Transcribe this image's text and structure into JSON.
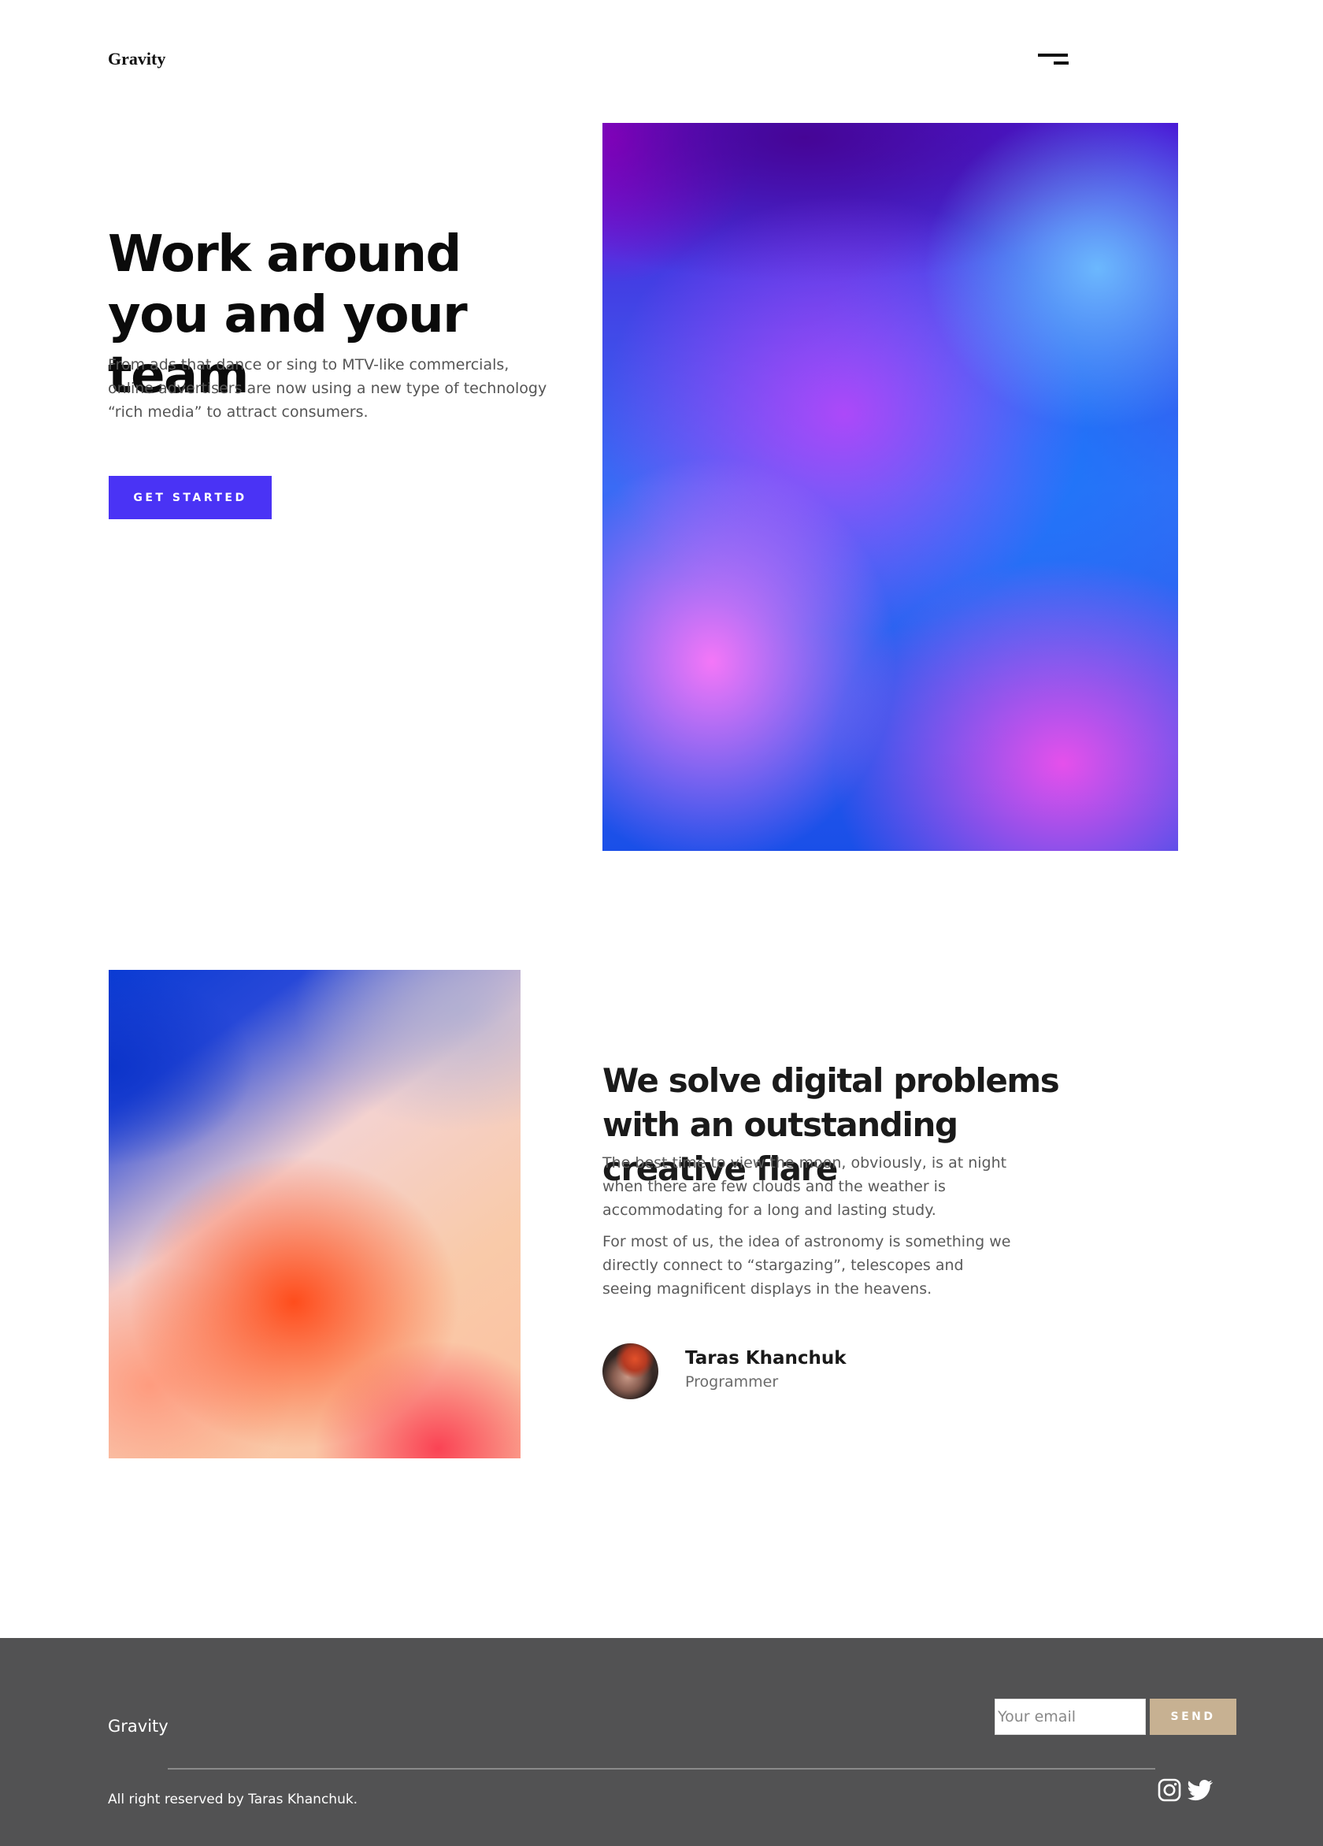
{
  "header": {
    "logo": "Gravity",
    "menu_icon": "menu-icon"
  },
  "hero": {
    "title": "Work around you and your team",
    "text": "From ads that dance or sing to MTV-like commercials, online advertisers are now using a new type of technology “rich media” to attract consumers.",
    "button_label": "GET STARTED"
  },
  "feature": {
    "title": "We solve digital problems with an outstanding creative flare",
    "paragraph_1": "The best time to view the moon, obviously, is at night when there are few clouds and the weather is accommodating for a long and lasting study.",
    "paragraph_2": "For most of us, the idea of astronomy is something we directly connect to “stargazing”, telescopes and seeing magnificent displays in the heavens.",
    "author": {
      "name": "Taras Khanchuk",
      "role": "Programmer"
    }
  },
  "footer": {
    "logo": "Gravity",
    "email_placeholder": "Your email",
    "send_label": "SEND",
    "copyright": "All right reserved by Taras Khanchuk.",
    "social_icons": [
      "instagram-icon",
      "twitter-icon"
    ]
  },
  "colors": {
    "primary_button": "#4a33f5",
    "send_button": "#c7b192",
    "footer_bg": "#525253"
  }
}
